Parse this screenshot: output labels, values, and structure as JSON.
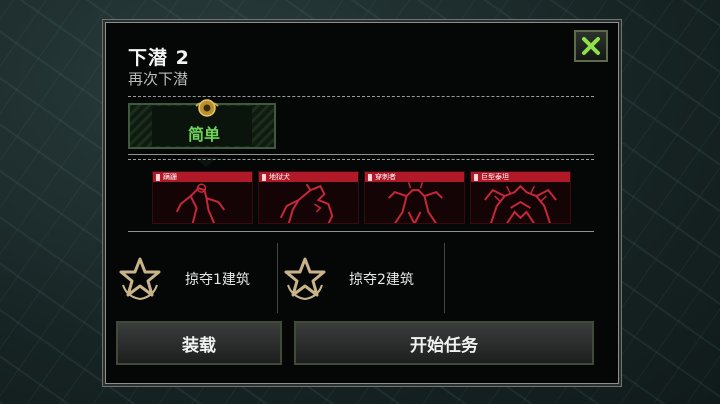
{
  "dialog": {
    "title": "下潜 2",
    "subtitle": "再次下潜",
    "close_icon": "close-x-icon"
  },
  "difficulty": {
    "label": "简单",
    "color": "#6fd458",
    "icon": "medal-icon"
  },
  "enemies": [
    {
      "name": "蹒跚",
      "icon": "zombie-walker-icon"
    },
    {
      "name": "地狱犬",
      "icon": "hellhound-icon"
    },
    {
      "name": "穿刺者",
      "icon": "impaler-icon"
    },
    {
      "name": "巨型泰坦",
      "icon": "titan-icon"
    }
  ],
  "tasks": [
    {
      "label": "掠夺1建筑",
      "icon": "star-wreath-icon"
    },
    {
      "label": "掠夺2建筑",
      "icon": "star-wreath-icon"
    }
  ],
  "buttons": {
    "loadout": "装载",
    "start": "开始任务"
  },
  "colors": {
    "enemy_header": "#b01a28",
    "task_icon": "#c9b48a",
    "close_icon": "#8fe04a"
  }
}
